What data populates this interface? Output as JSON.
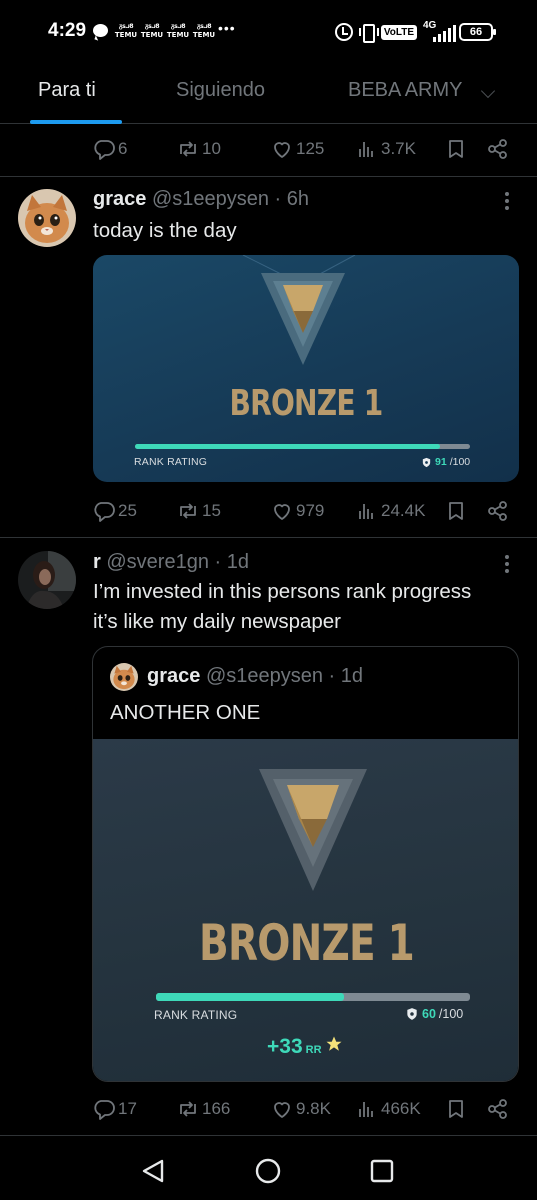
{
  "status_bar": {
    "time": "4:29",
    "notif_label": "TEMU",
    "notif_count": 4,
    "more": "•••",
    "volte": "VoLTE",
    "network": "4G",
    "battery": "66"
  },
  "tabs": [
    {
      "label": "Para ti",
      "active": true
    },
    {
      "label": "Siguiendo",
      "active": false
    },
    {
      "label": "BEBA ARMY",
      "active": false
    }
  ],
  "top_actions": {
    "replies": "6",
    "reposts": "10",
    "likes": "125",
    "views": "3.7K"
  },
  "tweet1": {
    "name": "grace",
    "handle": "@s1eepysen",
    "time": "· 6h",
    "text": "today is the day",
    "media": {
      "rank": "BRONZE 1",
      "rr_label": "RANK RATING",
      "rr_value": "91",
      "rr_max": "/100",
      "rr_fraction": 0.91
    },
    "actions": {
      "replies": "25",
      "reposts": "15",
      "likes": "979",
      "views": "24.4K"
    }
  },
  "tweet2": {
    "name": "r",
    "handle": "@svere1gn",
    "time": "· 1d",
    "text_line1": "I’m invested in this persons rank progress",
    "text_line2": "it’s like my daily newspaper",
    "quote": {
      "name": "grace",
      "handle": "@s1eepysen",
      "time": "· 1d",
      "text": "ANOTHER ONE",
      "media": {
        "rank": "BRONZE 1",
        "rr_label": "RANK RATING",
        "rr_value": "60",
        "rr_max": "/100",
        "rr_fraction": 0.6,
        "gain": "+33",
        "gain_unit": "RR"
      }
    },
    "actions": {
      "replies": "17",
      "reposts": "166",
      "likes": "9.8K",
      "views": "466K"
    }
  },
  "colors": {
    "accent": "#1d9bf0",
    "muted": "#71767b",
    "rr_green": "#3ed9b9",
    "bronze": "#b89a6c"
  },
  "icons": [
    "reply-icon",
    "repost-icon",
    "like-icon",
    "views-icon",
    "bookmark-icon",
    "share-icon",
    "more-icon",
    "back-icon",
    "home-icon",
    "recents-icon"
  ]
}
